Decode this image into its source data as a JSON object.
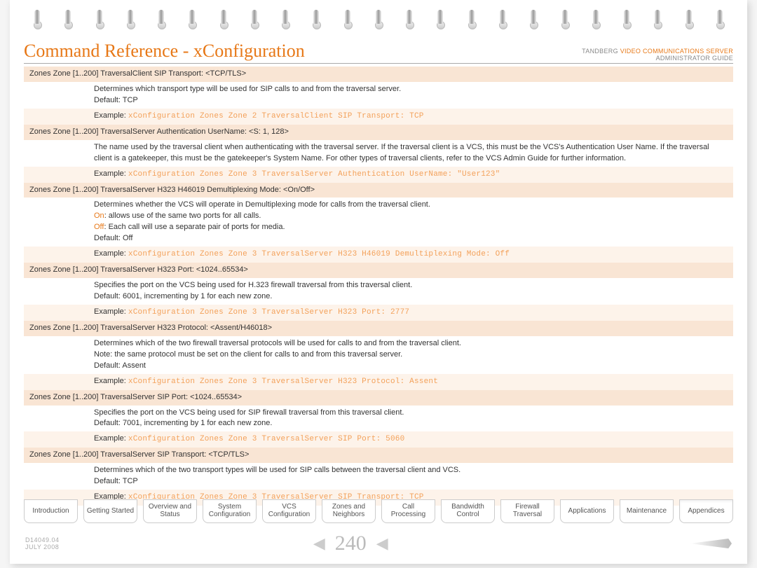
{
  "header": {
    "title": "Command Reference - xConfiguration",
    "brand": "TANDBERG",
    "product": "VIDEO COMMUNICATIONS SERVER",
    "guide": "ADMINISTRATOR GUIDE"
  },
  "commands": [
    {
      "title": "Zones Zone [1..200] TraversalClient SIP Transport: <TCP/TLS>",
      "lines": [
        "Determines which transport type will be used for SIP calls to and from the traversal server.",
        "Default: TCP"
      ],
      "example_label": "Example:",
      "example_code": "xConfiguration Zones Zone 2 TraversalClient SIP Transport: TCP"
    },
    {
      "title": "Zones Zone [1..200] TraversalServer Authentication UserName: <S: 1, 128>",
      "lines": [
        "The name used by the traversal client when authenticating with the traversal server. If the traversal client is a VCS, this must be the VCS's Authentication User Name. If the traversal client is a gatekeeper, this must be the gatekeeper's System Name. For other types of traversal clients, refer to the VCS Admin Guide for further information."
      ],
      "example_label": "Example:",
      "example_code": "xConfiguration Zones Zone 3 TraversalServer Authentication UserName: \"User123\""
    },
    {
      "title": "Zones Zone [1..200] TraversalServer H323 H46019 Demultiplexing Mode: <On/Off>",
      "lines": [
        "Determines whether the VCS will operate in Demultiplexing mode for calls from the traversal client."
      ],
      "special": [
        {
          "prefix": "On",
          "text": ": allows use of the same two ports for all calls."
        },
        {
          "prefix": "Off",
          "text": ": Each call will use a separate pair of ports for media."
        }
      ],
      "lines2": [
        "Default: Off"
      ],
      "example_label": "Example:",
      "example_code": "xConfiguration Zones Zone 3 TraversalServer H323 H46019 Demultiplexing Mode: Off"
    },
    {
      "title": "Zones Zone [1..200] TraversalServer H323 Port: <1024..65534>",
      "lines": [
        "Specifies the port on the VCS being used for H.323 firewall traversal from this traversal client.",
        "Default: 6001, incrementing by 1 for each new zone."
      ],
      "example_label": "Example:",
      "example_code": "xConfiguration Zones Zone 3 TraversalServer H323 Port: 2777"
    },
    {
      "title": "Zones Zone [1..200] TraversalServer H323 Protocol: <Assent/H46018>",
      "lines": [
        "Determines which of the two firewall traversal protocols will be used for calls to and from the traversal client.",
        "Note: the same protocol must be set on the client for calls to and from this traversal server.",
        "Default: Assent"
      ],
      "example_label": "Example:",
      "example_code": "xConfiguration Zones Zone 3 TraversalServer H323 Protocol: Assent"
    },
    {
      "title": "Zones Zone [1..200] TraversalServer SIP Port: <1024..65534>",
      "lines": [
        "Specifies the port on the VCS being used for SIP firewall traversal from this traversal client.",
        "Default: 7001, incrementing by 1 for each new zone."
      ],
      "example_label": "Example:",
      "example_code": "xConfiguration Zones Zone 3 TraversalServer SIP Port: 5060"
    },
    {
      "title": "Zones Zone [1..200] TraversalServer SIP Transport: <TCP/TLS>",
      "lines": [
        "Determines which of the two transport types will be used for SIP calls between the traversal client and VCS.",
        "Default: TCP"
      ],
      "example_label": "Example:",
      "example_code": "xConfiguration Zones Zone 3 TraversalServer SIP Transport: TCP"
    }
  ],
  "tabs": [
    "Introduction",
    "Getting Started",
    "Overview and\nStatus",
    "System\nConfiguration",
    "VCS\nConfiguration",
    "Zones and\nNeighbors",
    "Call\nProcessing",
    "Bandwidth\nControl",
    "Firewall\nTraversal",
    "Applications",
    "Maintenance",
    "Appendices"
  ],
  "active_tab_index": 11,
  "footer": {
    "doc_id": "D14049.04",
    "doc_date": "JULY 2008",
    "page_number": "240"
  }
}
